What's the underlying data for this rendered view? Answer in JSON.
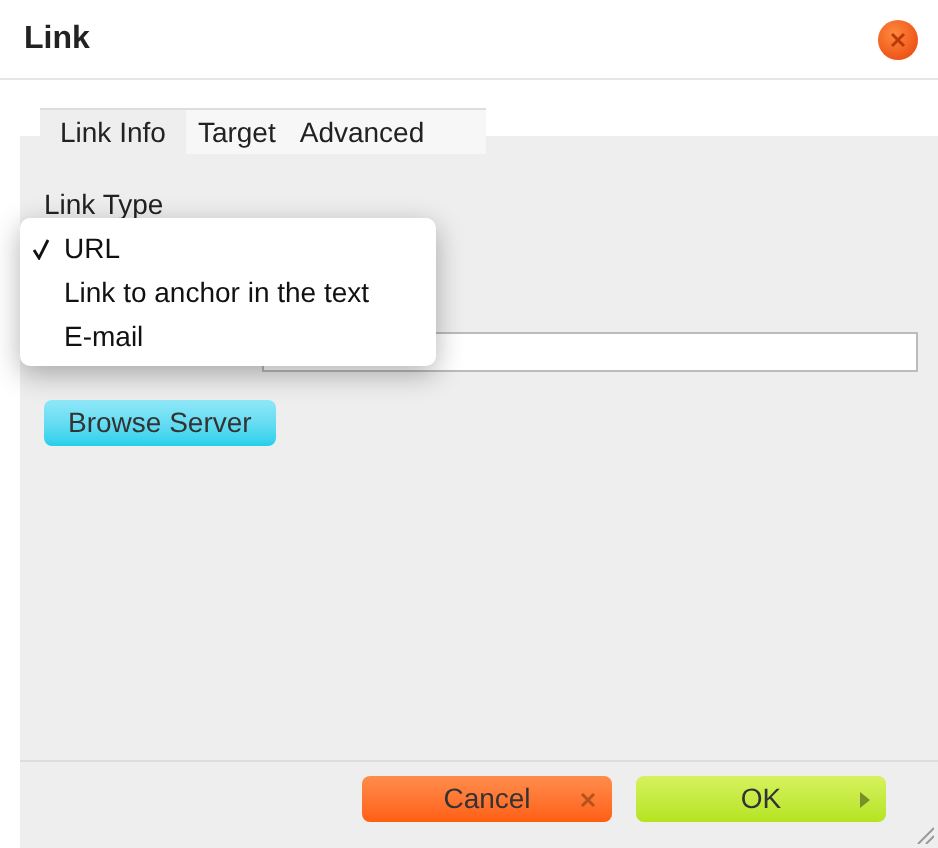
{
  "window": {
    "title": "Link"
  },
  "tabs": [
    {
      "label": "Link Info",
      "selected": true
    },
    {
      "label": "Target",
      "selected": false
    },
    {
      "label": "Advanced",
      "selected": false
    }
  ],
  "link_type": {
    "label": "Link Type",
    "menu": [
      {
        "label": "URL",
        "selected": true
      },
      {
        "label": "Link to anchor in the text",
        "selected": false
      },
      {
        "label": "E-mail",
        "selected": false
      }
    ]
  },
  "browse_button": "Browse Server",
  "buttons": [
    {
      "label": "Cancel",
      "kind": "cancel"
    },
    {
      "label": "OK",
      "kind": "ok"
    }
  ]
}
